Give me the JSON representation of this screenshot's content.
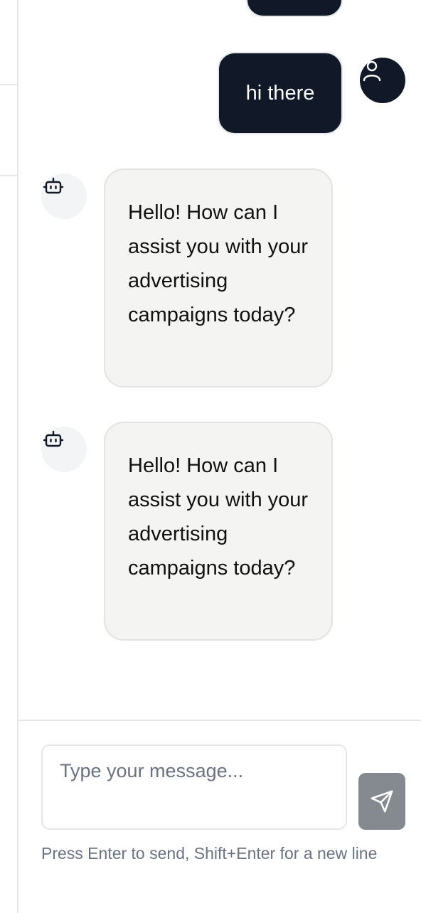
{
  "chat": {
    "messages": [
      {
        "role": "user",
        "text": "hi there"
      },
      {
        "role": "assistant",
        "text": "Hello! How can I assist you with your advertising campaigns today?"
      },
      {
        "role": "assistant",
        "text": "Hello! How can I assist you with your advertising campaigns today?"
      }
    ]
  },
  "composer": {
    "placeholder": "Type your message...",
    "value": "",
    "hint": "Press Enter to send, Shift+Enter for a new line"
  },
  "icons": {
    "user_avatar": "user-icon",
    "bot_avatar": "bot-icon",
    "send": "send-icon"
  },
  "colors": {
    "user_bubble": "#111827",
    "bot_bubble": "#f4f4f3",
    "send_button": "#858a91"
  }
}
